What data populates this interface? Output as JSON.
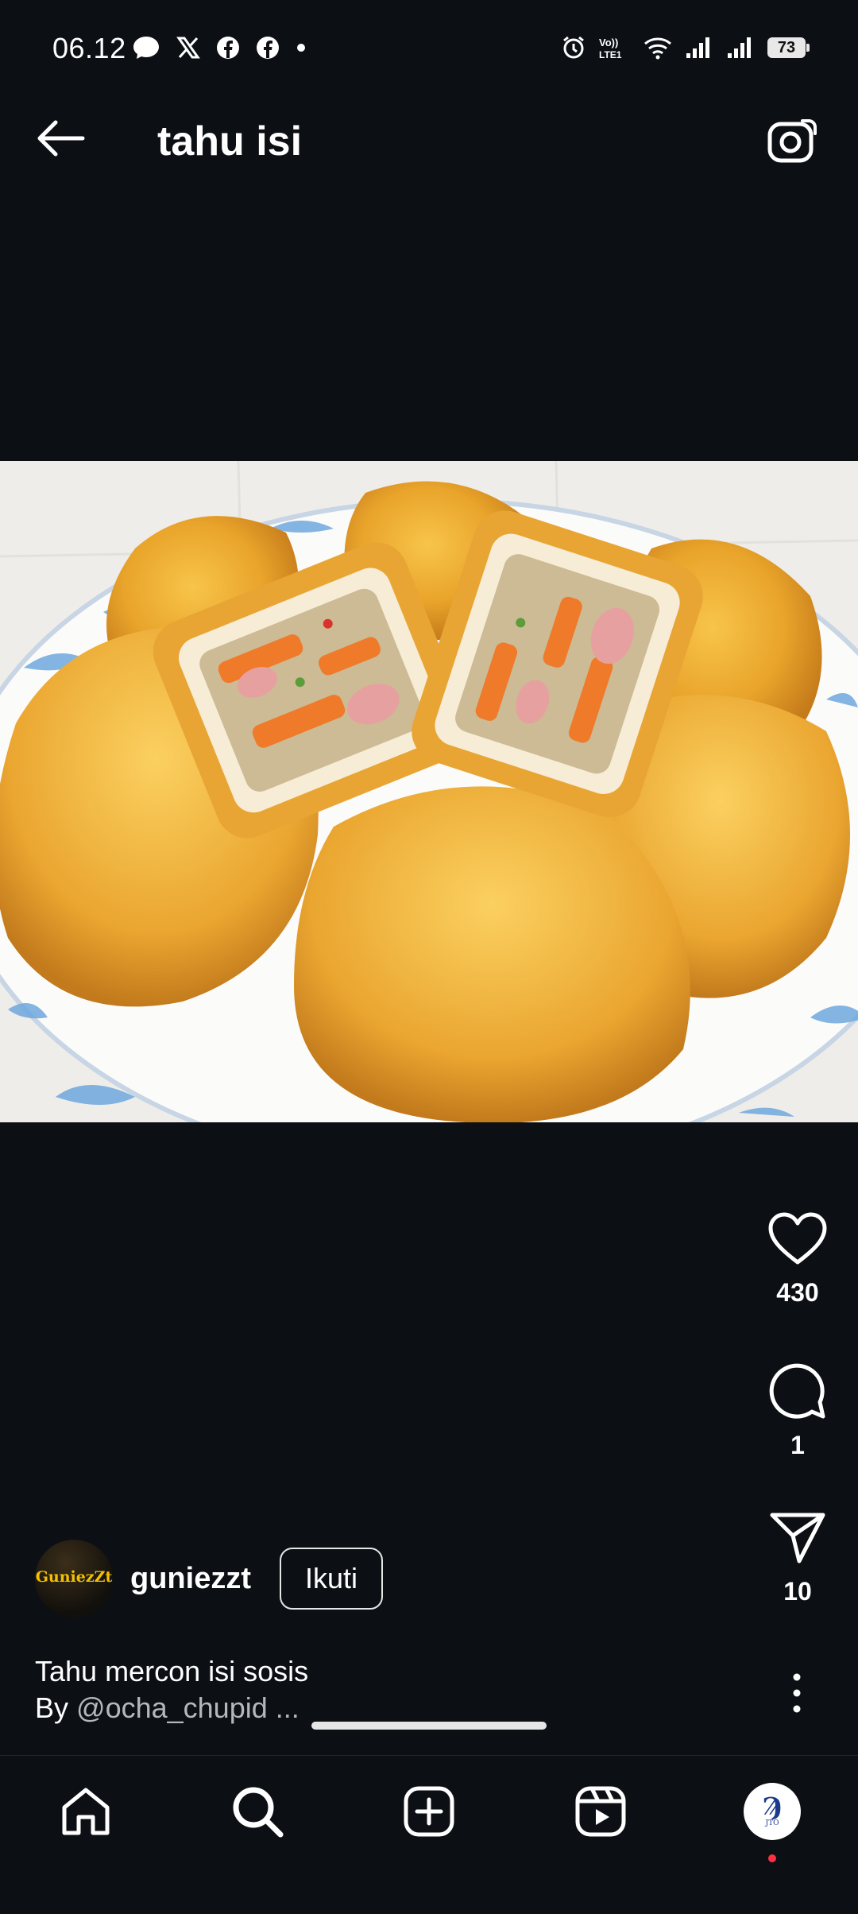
{
  "status_bar": {
    "time": "06.12",
    "left_icons": [
      "message-bubble-icon",
      "x-logo-icon",
      "facebook-icon",
      "facebook-icon",
      "dot-icon"
    ],
    "right_icons": [
      "alarm-icon",
      "volte-icon",
      "wifi-icon",
      "signal-icon",
      "signal-icon"
    ],
    "volte_label": "Vo)) LTE1",
    "battery": "73"
  },
  "header": {
    "title": "tahu isi",
    "back_icon": "arrow-left-icon",
    "camera_icon": "camera-icon"
  },
  "media": {
    "description_icon": "photo-fried-stuffed-tofu"
  },
  "actions": {
    "likes": "430",
    "comments": "1",
    "shares": "10"
  },
  "post": {
    "avatar_text": "GuniezZt",
    "username": "guniezzt",
    "follow_label": "Ikuti",
    "caption_line1": "Tahu mercon isi sosis",
    "caption_by": "By",
    "caption_handle": "@ocha_chupid",
    "caption_more": "..."
  },
  "bottom_nav": {
    "items": [
      "home-icon",
      "search-icon",
      "create-icon",
      "reels-icon",
      "profile-avatar"
    ],
    "profile_glyph": "Ϡ",
    "profile_small": "JTO"
  },
  "colors": {
    "background": "#0c0f14",
    "text": "#ffffff",
    "secondary_text": "#b4b8bd",
    "notification_dot": "#ff3040"
  }
}
